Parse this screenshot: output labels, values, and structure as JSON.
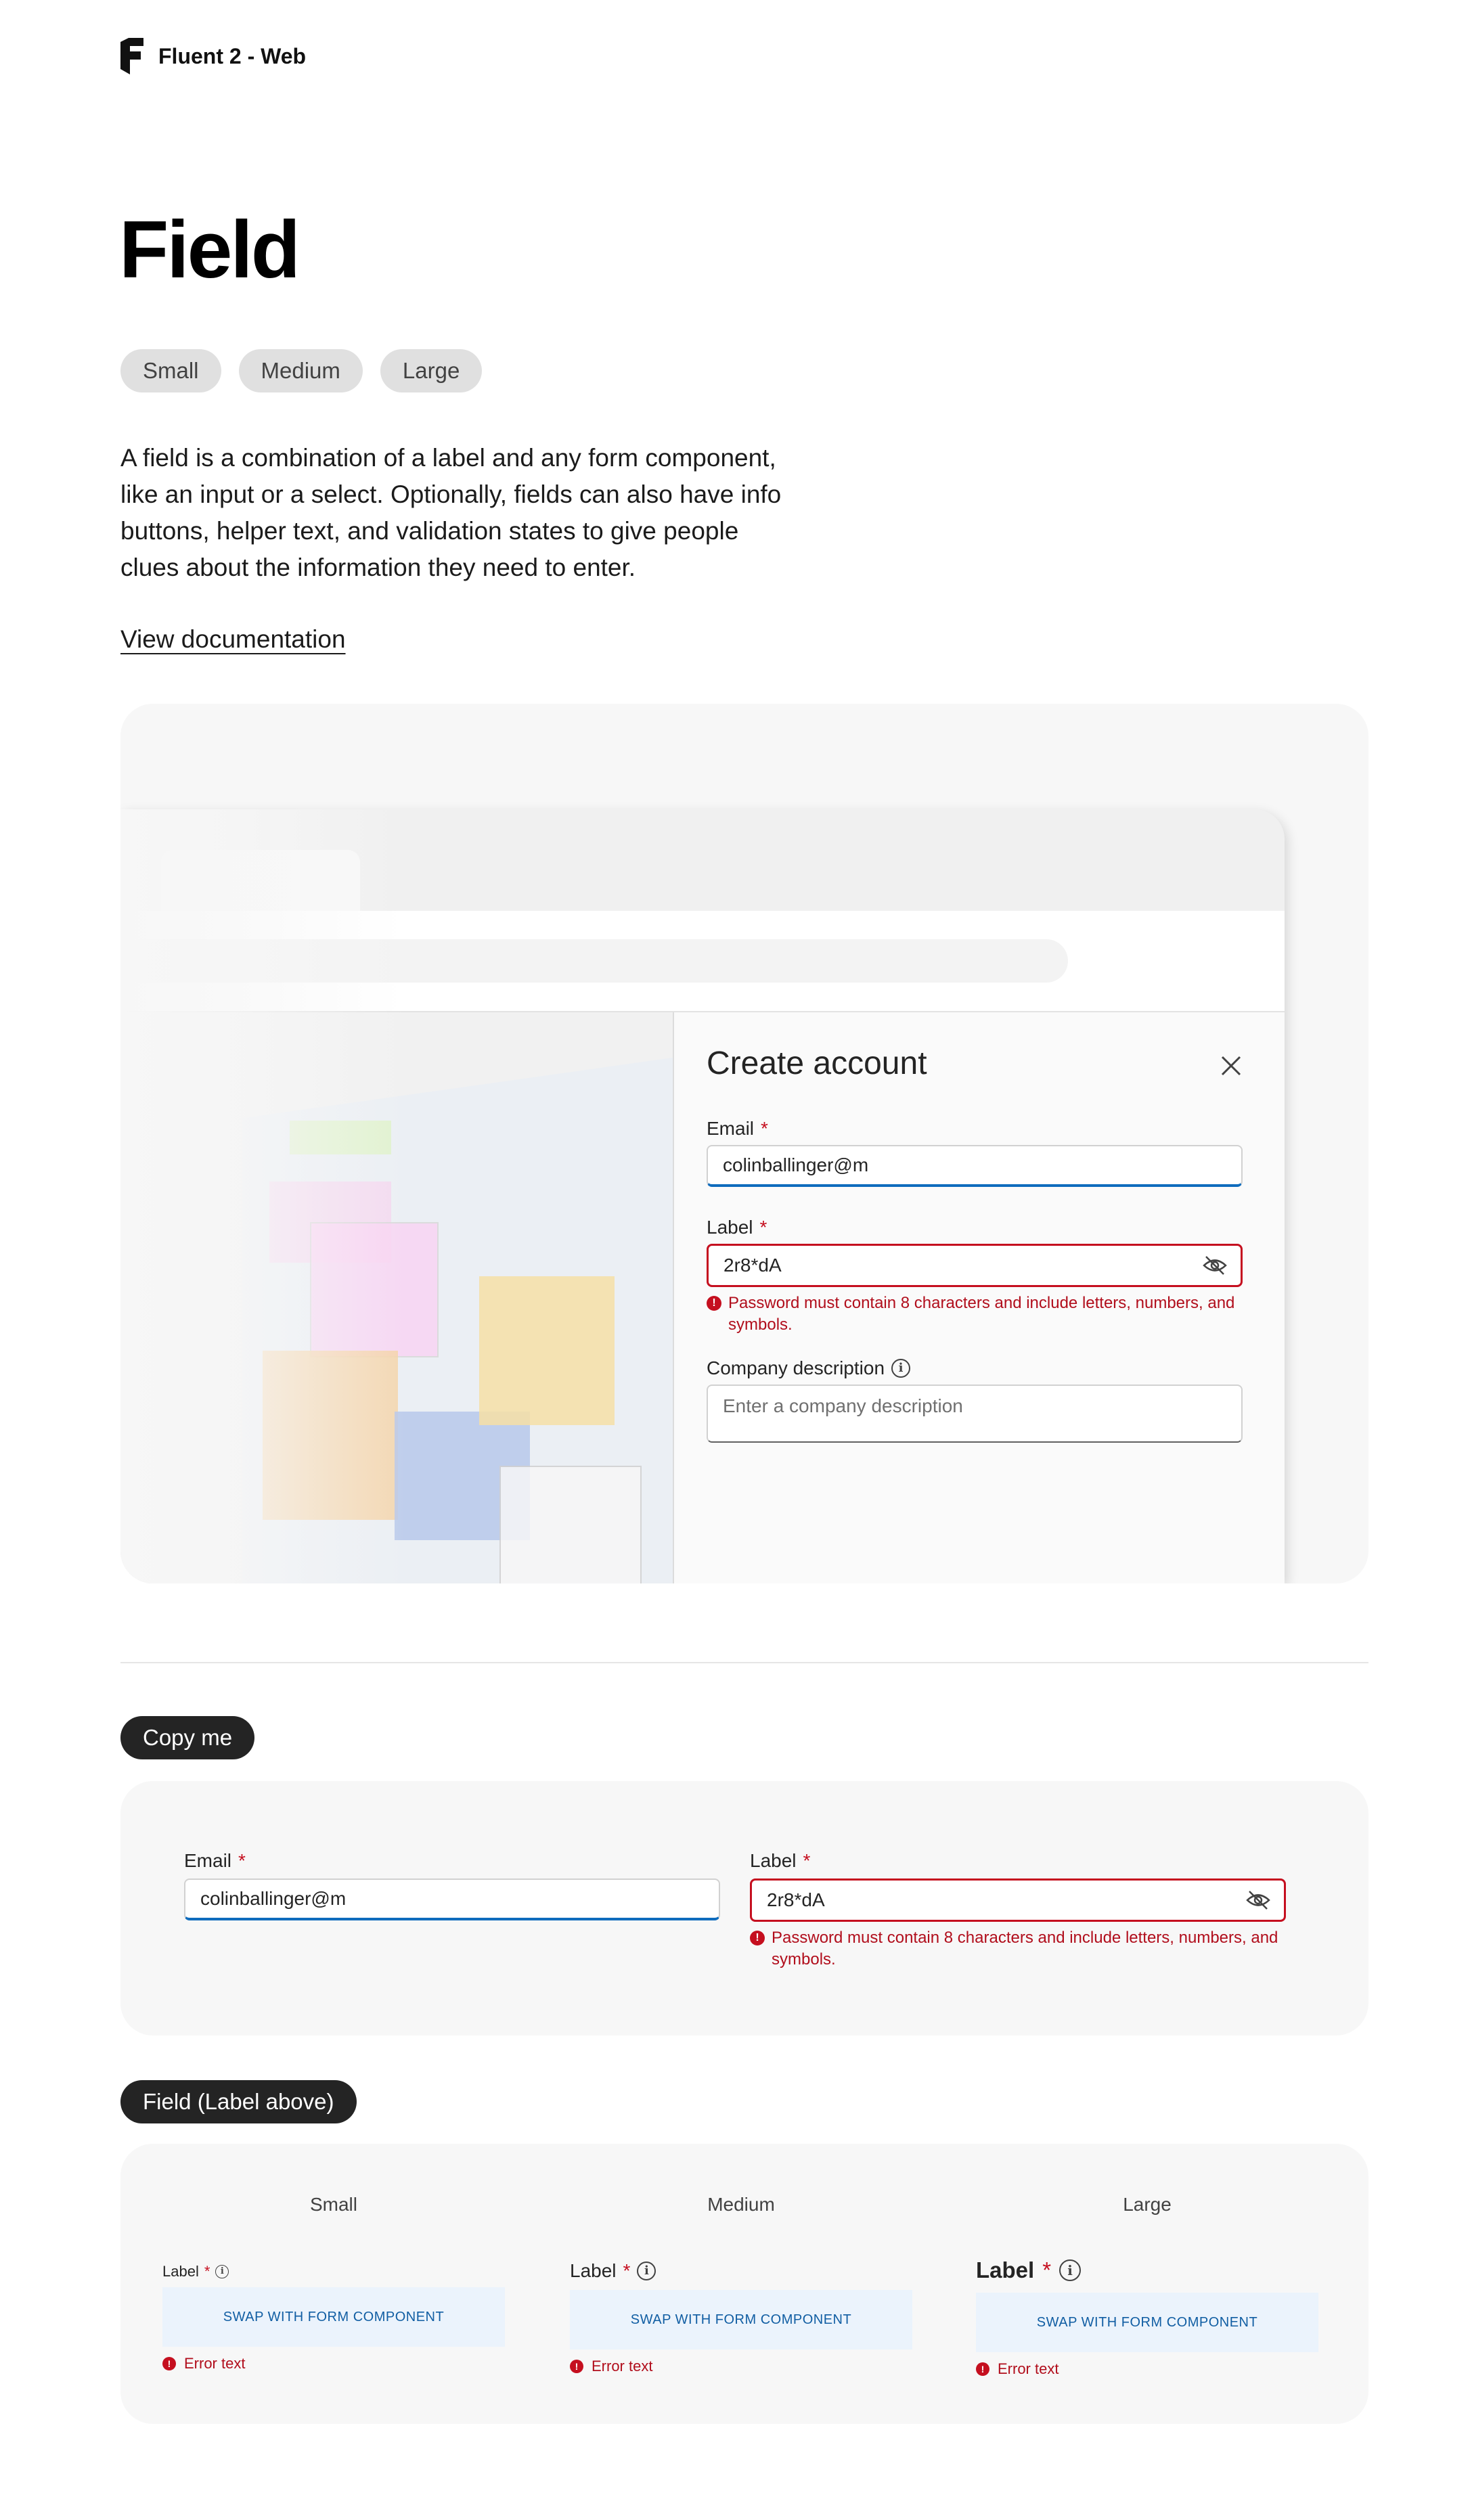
{
  "brand": {
    "name": "Fluent 2 - Web"
  },
  "page": {
    "title": "Field"
  },
  "size_chips": [
    "Small",
    "Medium",
    "Large"
  ],
  "intro": "A field is a combination of a label and any form component, like an input or a select. Optionally, fields can also have info buttons, helper text, and validation states to give people clues about the information they need to enter.",
  "doc_link": "View documentation",
  "hero": {
    "dialog": {
      "title": "Create account",
      "email_label": "Email",
      "required_mark": "*",
      "email_value": "colinballinger@m",
      "password_label": "Label",
      "password_value": "2r8*dA",
      "password_error": "Password must contain 8 characters and include letters, numbers, and symbols.",
      "company_label": "Company description",
      "company_placeholder": "Enter a company description"
    }
  },
  "copy_me": {
    "pill": "Copy me",
    "email_label": "Email",
    "email_value": "colinballinger@m",
    "password_label": "Label",
    "password_value": "2r8*dA",
    "password_error": "Password must contain 8 characters and include letters, numbers, and symbols."
  },
  "label_above": {
    "pill": "Field (Label above)",
    "columns": [
      {
        "heading": "Small",
        "label": "Label",
        "placeholder": "SWAP WITH FORM COMPONENT",
        "error": "Error text"
      },
      {
        "heading": "Medium",
        "label": "Label",
        "placeholder": "SWAP WITH FORM COMPONENT",
        "error": "Error text"
      },
      {
        "heading": "Large",
        "label": "Label",
        "placeholder": "SWAP WITH FORM COMPONENT",
        "error": "Error text"
      }
    ]
  },
  "colors": {
    "brand_blue": "#0f6cbd",
    "error_red": "#c50f1f",
    "swap_bg": "#ebf3fc",
    "card_bg": "#f7f7f7"
  },
  "icons": [
    "fluent-logo-icon",
    "close-icon",
    "eye-off-icon",
    "info-icon",
    "error-icon"
  ]
}
